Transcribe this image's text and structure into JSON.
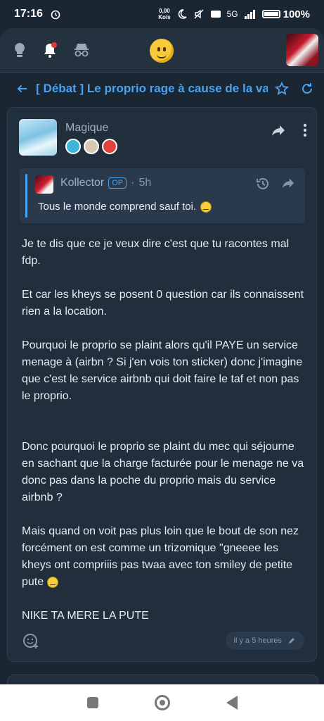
{
  "status_bar": {
    "time": "17:16",
    "speed_value": "0,00",
    "speed_unit": "Ko/s",
    "network": "5G",
    "battery": "100%"
  },
  "thread": {
    "title": "[ Débat ] Le proprio rage à cause de la vai"
  },
  "post": {
    "author": "Magique",
    "quote": {
      "author": "Kollector",
      "op_badge": "OP",
      "time": "5h",
      "text": "Tous le monde comprend sauf toi."
    },
    "paragraphs": [
      "Je te dis que ce je veux dire c'est que tu racontes mal fdp.",
      "Et car les kheys se posent 0 question car ils connaissent rien a la location.",
      "Pourquoi le proprio se plaint alors qu'il PAYE un service menage à (airbn ? Si j'en vois ton sticker) donc j'imagine que c'est le service airbnb qui doit faire le taf et non pas le proprio.",
      "Donc pourquoi le proprio se plaint du mec qui séjourne en sachant que la charge facturée pour le menage ne va donc pas dans la poche du proprio mais du service airbnb ?",
      "Mais quand on voit pas plus loin que le bout de son nez forcément on est comme un trizomique \"gneeee les kheys ont compriiis pas twaa avec ton smiley de petite pute",
      "NIKE TA MERE LA PUTE"
    ],
    "timestamp": "il y a 5 heures"
  },
  "icons": [
    "alarm-icon",
    "bulb-icon",
    "bell-icon",
    "incognito-icon",
    "back-arrow-icon",
    "star-icon",
    "refresh-icon",
    "share-icon",
    "more-icon",
    "history-icon",
    "add-reaction-icon",
    "edit-icon"
  ]
}
